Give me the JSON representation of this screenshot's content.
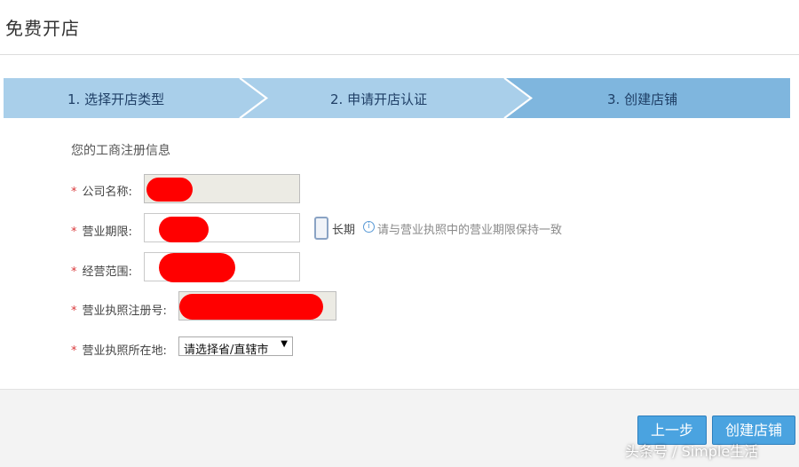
{
  "header": {
    "title": "免费开店"
  },
  "steps": [
    {
      "label": "1. 选择开店类型"
    },
    {
      "label": "2. 申请开店认证"
    },
    {
      "label": "3. 创建店铺"
    }
  ],
  "form": {
    "section_title": "您的工商注册信息",
    "required_mark": "*",
    "company_name": {
      "label": "公司名称:"
    },
    "business_term": {
      "label": "营业期限:",
      "long_term_label": "长期",
      "hint": "请与营业执照中的营业期限保持一致"
    },
    "business_scope": {
      "label": "经营范围:"
    },
    "license_number": {
      "label": "营业执照注册号:"
    },
    "license_location": {
      "label": "营业执照所在地:",
      "selected": "请选择省/直辖市"
    }
  },
  "buttons": {
    "prev": "上一步",
    "create": "创建店铺"
  },
  "watermark": "头条号 / Simple生活",
  "colors": {
    "step_done": "#a9cfea",
    "step_current": "#7fb6de",
    "button": "#4aa3e0",
    "required": "#d9383a"
  }
}
